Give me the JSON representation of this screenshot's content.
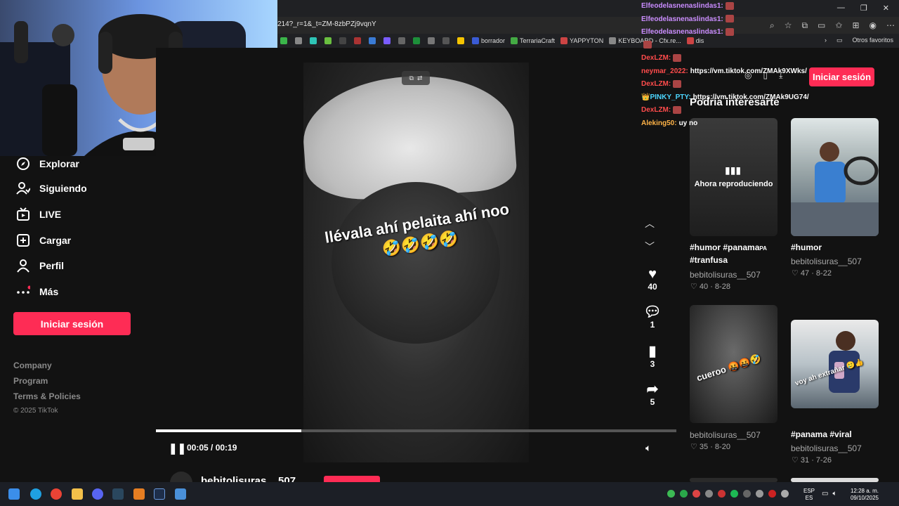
{
  "browser": {
    "url": "214?_r=1&_t=ZM-8zbPZj9vqnY",
    "bookmarks": [
      "borrador",
      "TerrariaCraft",
      "YAPPYTON",
      "KEYBOARD - Cfx.re...",
      "dis"
    ],
    "other_bookmarks": "Otros favoritos"
  },
  "sidebar": {
    "items": [
      {
        "label": "Explorar",
        "icon": "compass-icon"
      },
      {
        "label": "Siguiendo",
        "icon": "user-follow-icon"
      },
      {
        "label": "LIVE",
        "icon": "live-tv-icon"
      },
      {
        "label": "Cargar",
        "icon": "upload-plus-icon"
      },
      {
        "label": "Perfil",
        "icon": "person-icon"
      },
      {
        "label": "Más",
        "icon": "more-dots-icon"
      }
    ],
    "login_label": "Iniciar sesión",
    "footer": [
      "Company",
      "Program",
      "Terms & Policies"
    ],
    "copyright": "© 2025 TikTok"
  },
  "video": {
    "caption_line1": "llévala ahí pelaita ahí noo",
    "caption_line2": "🤣🤣🤣🤣",
    "time": "00:05 / 00:19",
    "progress": 0.28,
    "author": "bebitolisuras__507"
  },
  "actions": {
    "likes": "40",
    "comments": "1",
    "saves": "3",
    "shares": "5"
  },
  "right_panel": {
    "login_label": "Iniciar sesión",
    "title": "Podría interesarte",
    "now_playing": "Ahora reproduciendo",
    "cards": [
      {
        "title_line1": "#humor #panama",
        "title_suffix": "PA",
        "title_line2": "#tranfusa",
        "author": "bebitolisuras__507",
        "meta": "♡ 40 · 8-28"
      },
      {
        "title_line1": "#humor",
        "author": "bebitolisuras__507",
        "meta": "♡ 47 · 8-22"
      },
      {
        "overlay": "cueroo 🤬🤬🤣",
        "author": "bebitolisuras__507",
        "meta": "♡ 35 · 8-20"
      },
      {
        "overlay": "voy ah extrañar 🥲👍",
        "title_line1": "#panama #viral",
        "author": "bebitolisuras__507",
        "meta": "♡ 31 · 7-26"
      }
    ]
  },
  "chat": [
    {
      "user": "Elfeodelasnenaslindas1:",
      "msg": "",
      "color": "#c98cff"
    },
    {
      "user": "Elfeodelasnenaslindas1:",
      "msg": "",
      "color": "#c98cff"
    },
    {
      "user": "Elfeodelasnenaslindas1:",
      "msg": "",
      "color": "#c98cff"
    },
    {
      "user": "",
      "msg": "",
      "color": "#ff4c4c"
    },
    {
      "user": "DexLZM:",
      "msg": "",
      "color": "#ff4c4c"
    },
    {
      "user": "neymar_2022:",
      "msg": "https://vm.tiktok.com/ZMAk9XWks/",
      "color": "#ff4c4c"
    },
    {
      "user": "DexLZM:",
      "msg": "",
      "color": "#ff4c4c"
    },
    {
      "user": "👑PINKY_PTY:",
      "msg": "https://vm.tiktok.com/ZMAk9UG74/",
      "color": "#4cd6ff"
    },
    {
      "user": "DexLZM:",
      "msg": "",
      "color": "#ff4c4c"
    },
    {
      "user": "Aleking50:",
      "msg": "uy no",
      "color": "#ffb347"
    }
  ],
  "taskbar": {
    "lang1": "ESP",
    "lang2": "ES",
    "time": "12:28 a. m.",
    "date": "09/10/2025"
  },
  "colors": {
    "accent": "#fe2c55",
    "background": "#121212"
  }
}
